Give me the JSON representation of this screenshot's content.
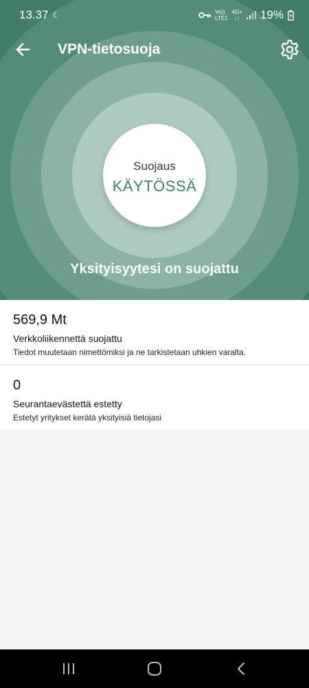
{
  "status_bar": {
    "time": "13.37",
    "network_top": "Vo))",
    "network_bottom": "LTE1",
    "data_type": "4G+",
    "battery": "19%"
  },
  "app_bar": {
    "title": "VPN-tietosuoja"
  },
  "protection": {
    "label": "Suojaus",
    "status": "KÄYTÖSSÄ",
    "caption": "Yksityisyytesi on suojattu"
  },
  "stats": [
    {
      "value": "569,9 Mt",
      "title": "Verkkoliikennettä suojattu",
      "description": "Tiedot muutetaan nimettömiksi ja ne tarkistetaan uhkien varalta."
    },
    {
      "value": "0",
      "title": "Seurantaevästettä estetty",
      "description": "Estetyt yritykset kerätä yksityisiä tietojasi"
    }
  ],
  "colors": {
    "hero": "#427d6a",
    "accent": "#3f7d69"
  }
}
